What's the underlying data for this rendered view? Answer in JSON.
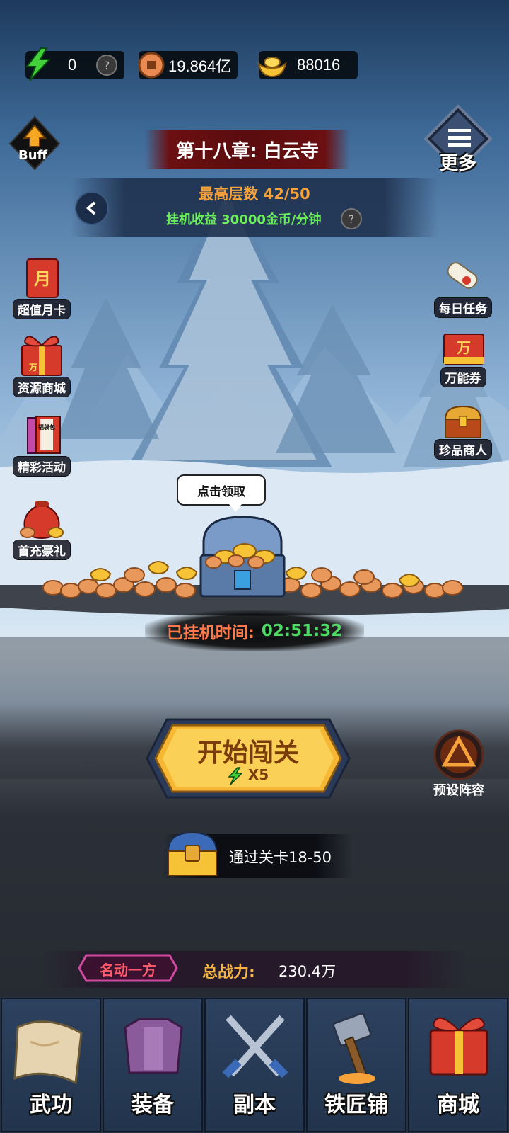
{
  "resources": {
    "energy": "0",
    "energy_help": "?",
    "copper": "19.864亿",
    "gold": "88016"
  },
  "buff_label": "Buff",
  "more_label": "更多",
  "chapter": {
    "title": "第十八章: 白云寺",
    "max_floor_label": "最高层数",
    "max_floor_value": "42/50",
    "idle_income": "挂机收益 30000金币/分钟",
    "help": "?"
  },
  "left_menu": [
    {
      "label": "超值月卡",
      "icon_text": "月"
    },
    {
      "label": "资源商城",
      "icon_text": "万"
    },
    {
      "label": "精彩活动",
      "icon_text": "福袋包"
    },
    {
      "label": "首充豪礼"
    }
  ],
  "right_menu": [
    {
      "label": "每日任务"
    },
    {
      "label": "万能券",
      "icon_text": "万"
    },
    {
      "label": "珍品商人"
    }
  ],
  "claim_bubble": "点击领取",
  "afk": {
    "label": "已挂机时间:",
    "time": "02:51:32"
  },
  "start_button": {
    "label": "开始闯关",
    "cost": "X5"
  },
  "formation_label": "预设阵容",
  "stage_reward": "通过关卡18-50",
  "power": {
    "title_badge": "名动一方",
    "label": "总战力:",
    "value": "230.4万"
  },
  "nav_tabs": [
    {
      "label": "武功"
    },
    {
      "label": "装备"
    },
    {
      "label": "副本"
    },
    {
      "label": "铁匠铺"
    },
    {
      "label": "商城"
    }
  ],
  "colors": {
    "gold_text": "#f5b342",
    "green_text": "#4cd964",
    "income_green": "#6cf05a",
    "floor_orange": "#f6a23b"
  }
}
